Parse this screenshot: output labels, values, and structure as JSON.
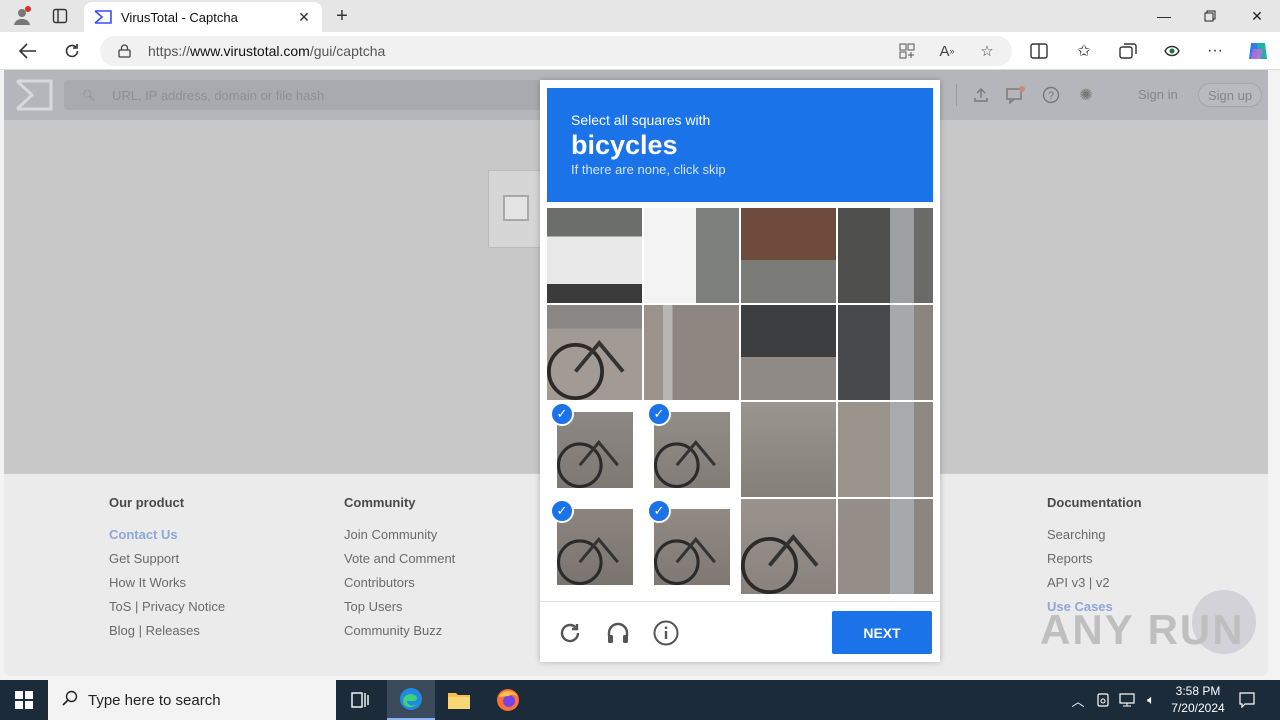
{
  "browser": {
    "tab_title": "VirusTotal - Captcha",
    "url_prefix": "https://",
    "url_domain": "www.virustotal.com",
    "url_path": "/gui/captcha",
    "icons": [
      "profile-icon",
      "workspaces-icon",
      "close-icon",
      "plus-icon",
      "back-icon",
      "refresh-icon",
      "lock-icon",
      "app-install-icon",
      "read-aloud-icon",
      "favorite-star-icon",
      "split-screen-icon",
      "favorites-icon",
      "collections-icon",
      "extensions-icon",
      "more-icon",
      "copilot-icon"
    ]
  },
  "vt": {
    "search_placeholder": "URL, IP address, domain or file hash",
    "signin": "Sign in",
    "signup": "Sign up"
  },
  "captcha": {
    "line1": "Select all squares with",
    "target": "bicycles",
    "line3": "If there are none, click skip",
    "next_label": "NEXT",
    "selected_cells": [
      8,
      9,
      12,
      13
    ],
    "accent_color": "#1a73e8"
  },
  "footer": {
    "product": {
      "heading": "Our product",
      "links": [
        "Contact Us",
        "Get Support",
        "How It Works",
        "ToS | Privacy Notice",
        "Blog | Releases"
      ]
    },
    "community": {
      "heading": "Community",
      "links": [
        "Join Community",
        "Vote and Comment",
        "Contributors",
        "Top Users",
        "Community Buzz"
      ]
    },
    "docs": {
      "heading": "Documentation",
      "links": [
        "Searching",
        "Reports",
        "API v3 | v2",
        "Use Cases"
      ]
    }
  },
  "watermark": "ANY RUN",
  "taskbar": {
    "search_placeholder": "Type here to search",
    "time": "3:58 PM",
    "date": "7/20/2024"
  }
}
